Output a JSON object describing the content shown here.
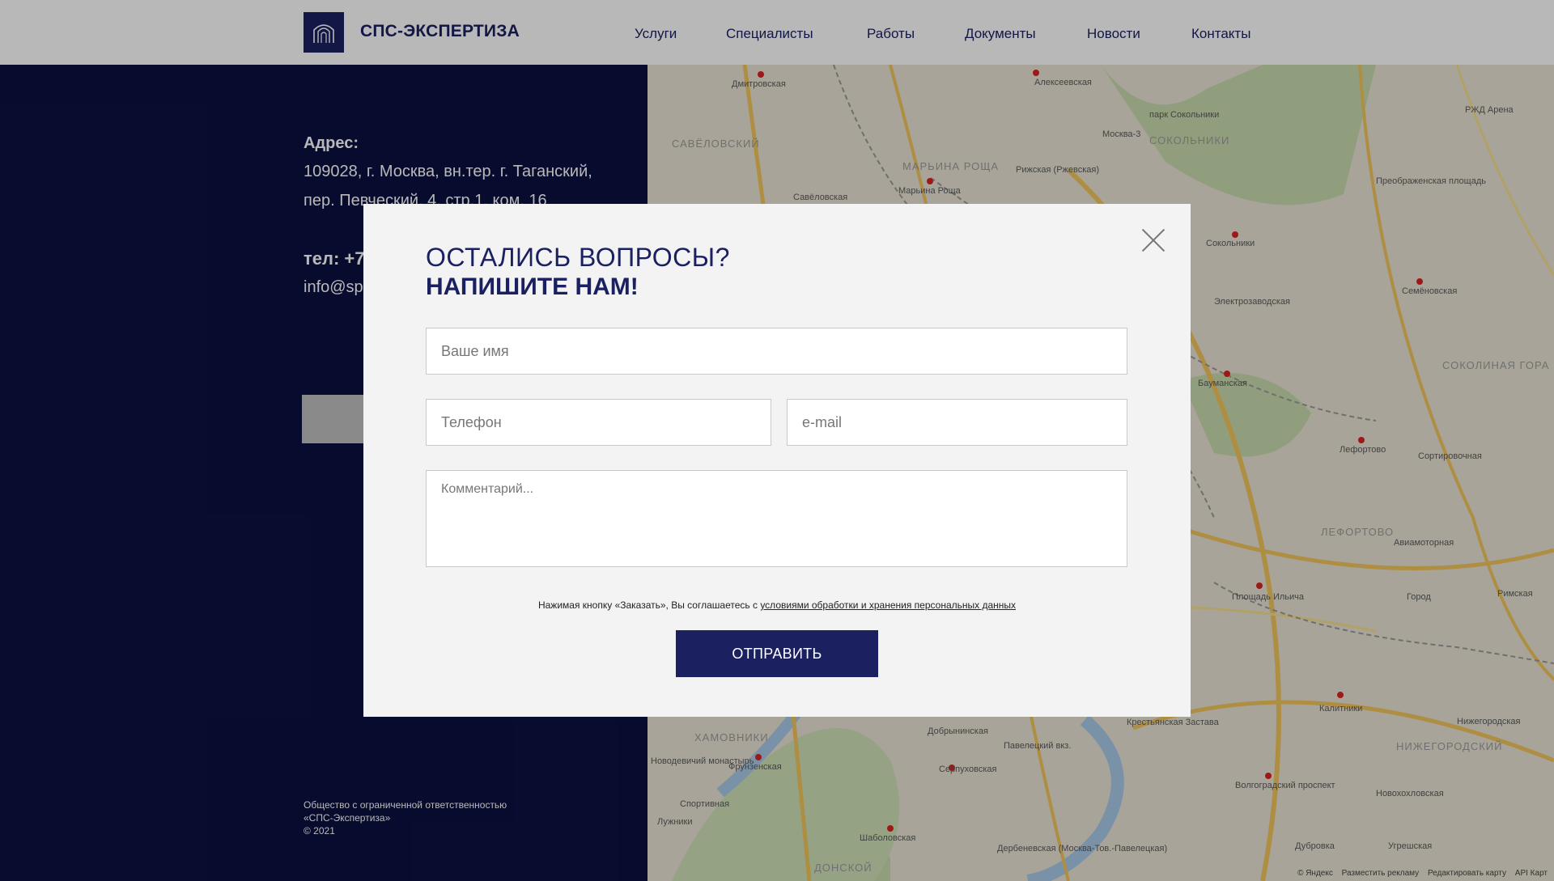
{
  "header": {
    "logo_text": "СПС-ЭКСПЕРТИЗА",
    "nav": [
      "Услуги",
      "Специалисты",
      "Работы",
      "Документы",
      "Новости",
      "Контакты"
    ]
  },
  "contacts": {
    "address_label": "Адрес:",
    "address_line1": "109028, г. Москва, вн.тер. г. Таганский,",
    "address_line2": "пер. Певческий, 4, стр.1, ком. 16",
    "tel": "тел: +7",
    "email": "info@sps"
  },
  "footer": {
    "line1": "Общество с ограниченной ответственностью",
    "line2": "«СПС-Экспертиза»",
    "line3": "© 2021"
  },
  "map": {
    "districts": [
      "САВЁЛОВСКИЙ",
      "МАРЬИНА РОЩА",
      "СОКОЛЬНИКИ",
      "СОКОЛИНАЯ ГОРА",
      "ЛЕФОРТОВО",
      "ХАМОВНИКИ",
      "НИЖЕГОРОДСКИЙ",
      "ДОНСКОЙ"
    ],
    "labels": [
      "Дмитровская",
      "Алексеевская",
      "Савёловская",
      "Марьина Роща",
      "Рижская (Ржевская)",
      "Москва-3",
      "парк Сокольники",
      "РЖД Арена",
      "Сокольники",
      "Преображенская площадь",
      "Электрозаводская",
      "Семёновская",
      "Бауманская",
      "Лефортово",
      "Сортировочная",
      "Авиамоторная",
      "Площадь Ильича",
      "Римская",
      "Калитники",
      "Нижегородская",
      "Фрунзенская",
      "Спортивная",
      "Шаболовская",
      "Серпуховская",
      "Павелецкий вкз.",
      "Добрынинская",
      "Крестьянская Застава",
      "Волгоградский проспект",
      "Новохохловская",
      "Дубровка",
      "Угрешская",
      "Дербеневская (Москва-Тов.-Павелецкая)",
      "Новодевичий монастырь",
      "Лужники",
      "Город"
    ],
    "footer": [
      "© Яндекс",
      "Разместить рекламу",
      "Редактировать карту",
      "API Карт"
    ]
  },
  "modal": {
    "title_line1": "ОСТАЛИСЬ ВОПРОСЫ?",
    "title_line2": "НАПИШИТЕ НАМ!",
    "name_placeholder": "Ваше имя",
    "phone_placeholder": "Телефон",
    "email_placeholder": "e-mail",
    "comment_placeholder": "Комментарий...",
    "consent_text": "Нажимая кнопку «Заказать», Вы соглашаетесь с ",
    "consent_link": "условиями обработки и хранения персональных данных",
    "submit_label": "ОТПРАВИТЬ"
  },
  "colors": {
    "brand": "#1b2160",
    "panel": "#0b1040",
    "modal_bg": "#f3f3f3"
  }
}
